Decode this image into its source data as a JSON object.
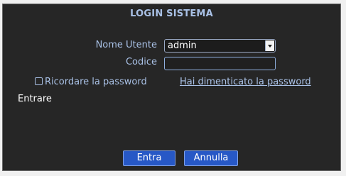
{
  "dialog": {
    "title": "LOGIN SISTEMA",
    "username_label": "Nome Utente",
    "username_value": "admin",
    "password_label": "Codice",
    "password_value": "",
    "remember_label": "Ricordare la password",
    "remember_checked": false,
    "forgot_link": "Hai dimenticato la password",
    "status_text": "Entrare",
    "ok_button": "Entra",
    "cancel_button": "Annulla"
  },
  "colors": {
    "background": "#262626",
    "label_text": "#a9c1e6",
    "button": "#2758c6"
  }
}
